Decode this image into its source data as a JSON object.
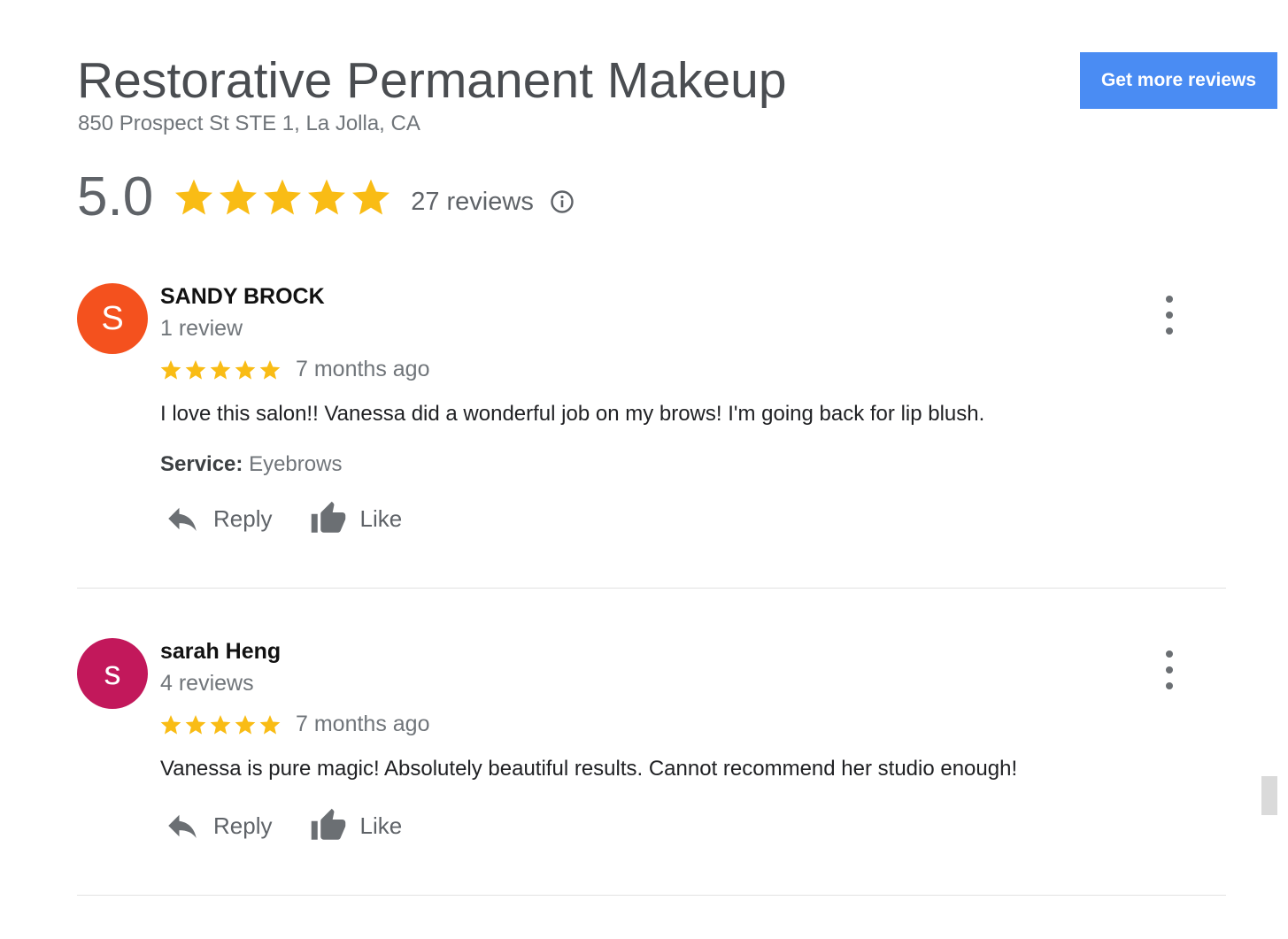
{
  "header": {
    "business_name": "Restorative Permanent Makeup",
    "address": "850 Prospect St STE 1, La Jolla, CA",
    "cta_label": "Get more reviews"
  },
  "summary": {
    "rating": "5.0",
    "star_count": 5,
    "reviews_label": "27 reviews"
  },
  "reviews": [
    {
      "initial": "S",
      "avatar_color": "#f4511e",
      "name": "SANDY BROCK",
      "review_count": "1 review",
      "stars": 5,
      "time": "7 months ago",
      "text": "I love this salon!! Vanessa did a wonderful job on my brows! I'm going back for lip blush.",
      "service_label": "Service:",
      "service_value": "Eyebrows"
    },
    {
      "initial": "s",
      "avatar_color": "#c2185b",
      "name": "sarah Heng",
      "review_count": "4 reviews",
      "stars": 5,
      "time": "7 months ago",
      "text": "Vanessa is pure magic! Absolutely beautiful results. Cannot recommend her  studio enough!"
    }
  ],
  "actions": {
    "reply_label": "Reply",
    "like_label": "Like"
  },
  "colors": {
    "star": "#f9bc15",
    "accent": "#4a8cf3",
    "icon_gray": "#6b6f73"
  }
}
